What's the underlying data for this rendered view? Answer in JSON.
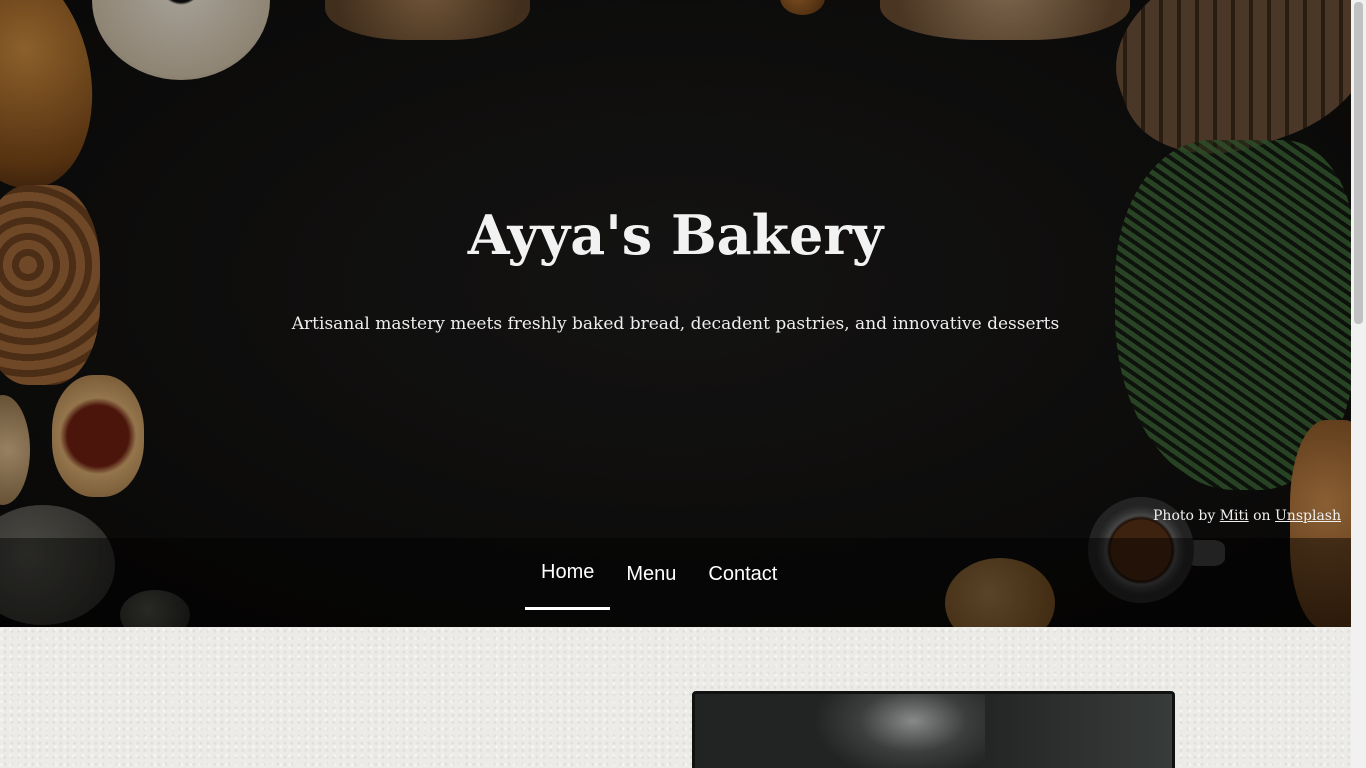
{
  "hero": {
    "title": "Ayya's Bakery",
    "tagline": "Artisanal mastery meets freshly baked bread, decadent pastries, and innovative desserts",
    "credit": {
      "prefix": "Photo by",
      "author": "Miti",
      "middle": "on",
      "source": "Unsplash"
    }
  },
  "nav": {
    "items": [
      {
        "label": "Home",
        "active": true
      },
      {
        "label": "Menu",
        "active": false
      },
      {
        "label": "Contact",
        "active": false
      }
    ]
  },
  "colors": {
    "hero_text": "#f2f2f2",
    "nav_active_underline": "#ffffff",
    "content_bg": "#ecebe8"
  }
}
